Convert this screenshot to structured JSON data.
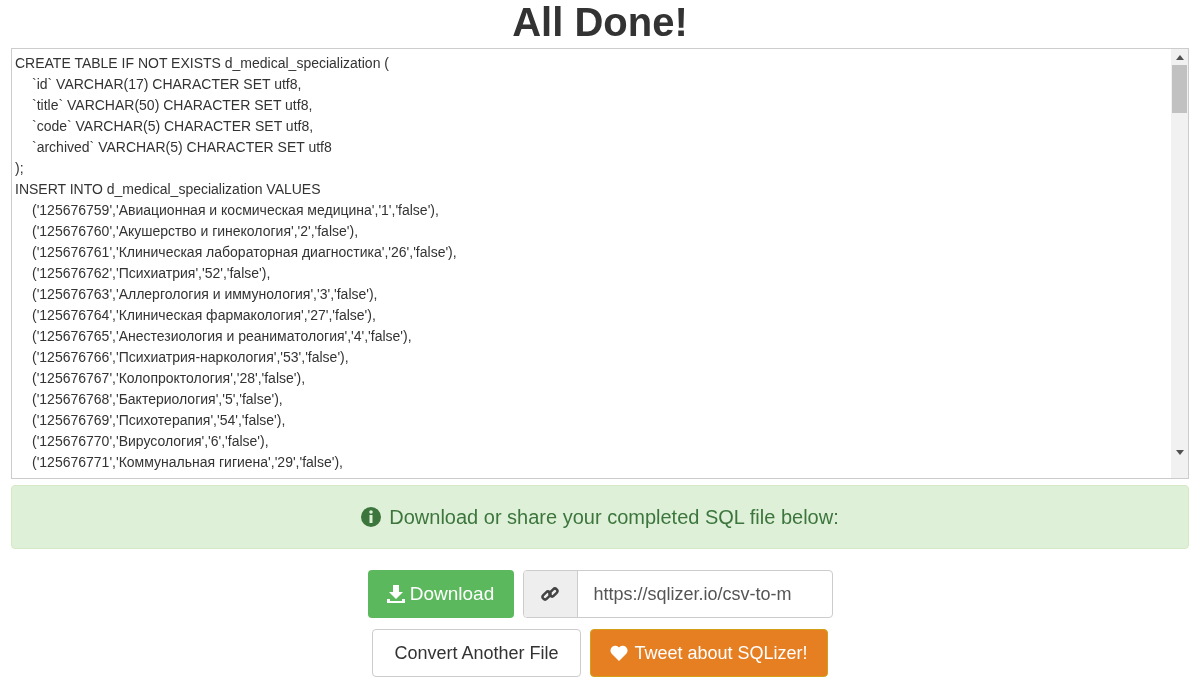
{
  "title": "All Done!",
  "sql_output": {
    "lines": [
      {
        "text": "CREATE TABLE IF NOT EXISTS d_medical_specialization (",
        "children": [
          {
            "text": "`id` VARCHAR(17) CHARACTER SET utf8,"
          },
          {
            "text": "`title` VARCHAR(50) CHARACTER SET utf8,"
          },
          {
            "text": "`code` VARCHAR(5) CHARACTER SET utf8,"
          },
          {
            "text": "`archived` VARCHAR(5) CHARACTER SET utf8"
          }
        ]
      },
      {
        "text": ");"
      },
      {
        "text": "INSERT INTO d_medical_specialization VALUES",
        "children": [
          {
            "text": "('125676759','Авиационная и космическая медицина','1','false'),"
          },
          {
            "text": "('125676760','Акушерство и гинекология','2','false'),"
          },
          {
            "text": "('125676761','Клиническая лабораторная диагностика','26','false'),"
          },
          {
            "text": "('125676762','Психиатрия','52','false'),"
          },
          {
            "text": "('125676763','Аллергология и иммунология','3','false'),"
          },
          {
            "text": "('125676764','Клиническая фармакология','27','false'),"
          },
          {
            "text": "('125676765','Анестезиология и реаниматология','4','false'),"
          },
          {
            "text": "('125676766','Психиатрия-наркология','53','false'),"
          },
          {
            "text": "('125676767','Колопроктология','28','false'),"
          },
          {
            "text": "('125676768','Бактериология','5','false'),"
          },
          {
            "text": "('125676769','Психотерапия','54','false'),"
          },
          {
            "text": "('125676770','Вирусология','6','false'),"
          },
          {
            "text": "('125676771','Коммунальная гигиена','29','false'),"
          }
        ]
      }
    ]
  },
  "alert": {
    "text": "Download or share your completed SQL file below:"
  },
  "download_button": {
    "label": "Download"
  },
  "share_link": {
    "value": "https://sqlizer.io/csv-to-m"
  },
  "convert_button": {
    "label": "Convert Another File"
  },
  "tweet_button": {
    "label": "Tweet about SQLizer!"
  }
}
